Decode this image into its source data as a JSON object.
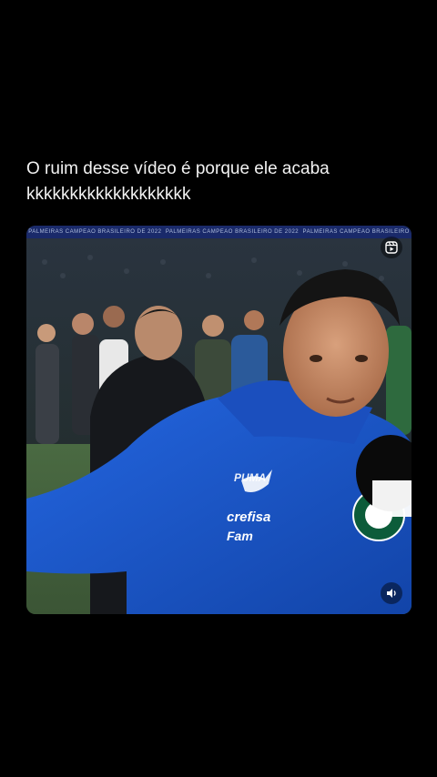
{
  "post": {
    "caption_line1": "O ruim desse vídeo é porque ele acaba",
    "caption_line2": "kkkkkkkkkkkkkkkkkkk"
  },
  "video": {
    "scoreboard_left": "PALMEIRAS CAMPEÃO BRASILEIRO DE 2022",
    "scoreboard_mid": "PALMEIRAS CAMPEÃO BRASILEIRO DE 2022",
    "scoreboard_right": "PALMEIRAS CAMPEÃO BRASILEIRO",
    "jacket_brand": "PUMA",
    "sponsor_line1": "crefisa",
    "sponsor_line2": "Fam",
    "crest_text": "PALMEIRAS"
  },
  "colors": {
    "background": "#000000",
    "caption_text": "#f2f2f2",
    "jacket_blue": "#1a56c9",
    "pitch_green": "#3e5a3a"
  },
  "icons": {
    "top_right": "reels-icon",
    "bottom_right": "speaker-icon"
  }
}
